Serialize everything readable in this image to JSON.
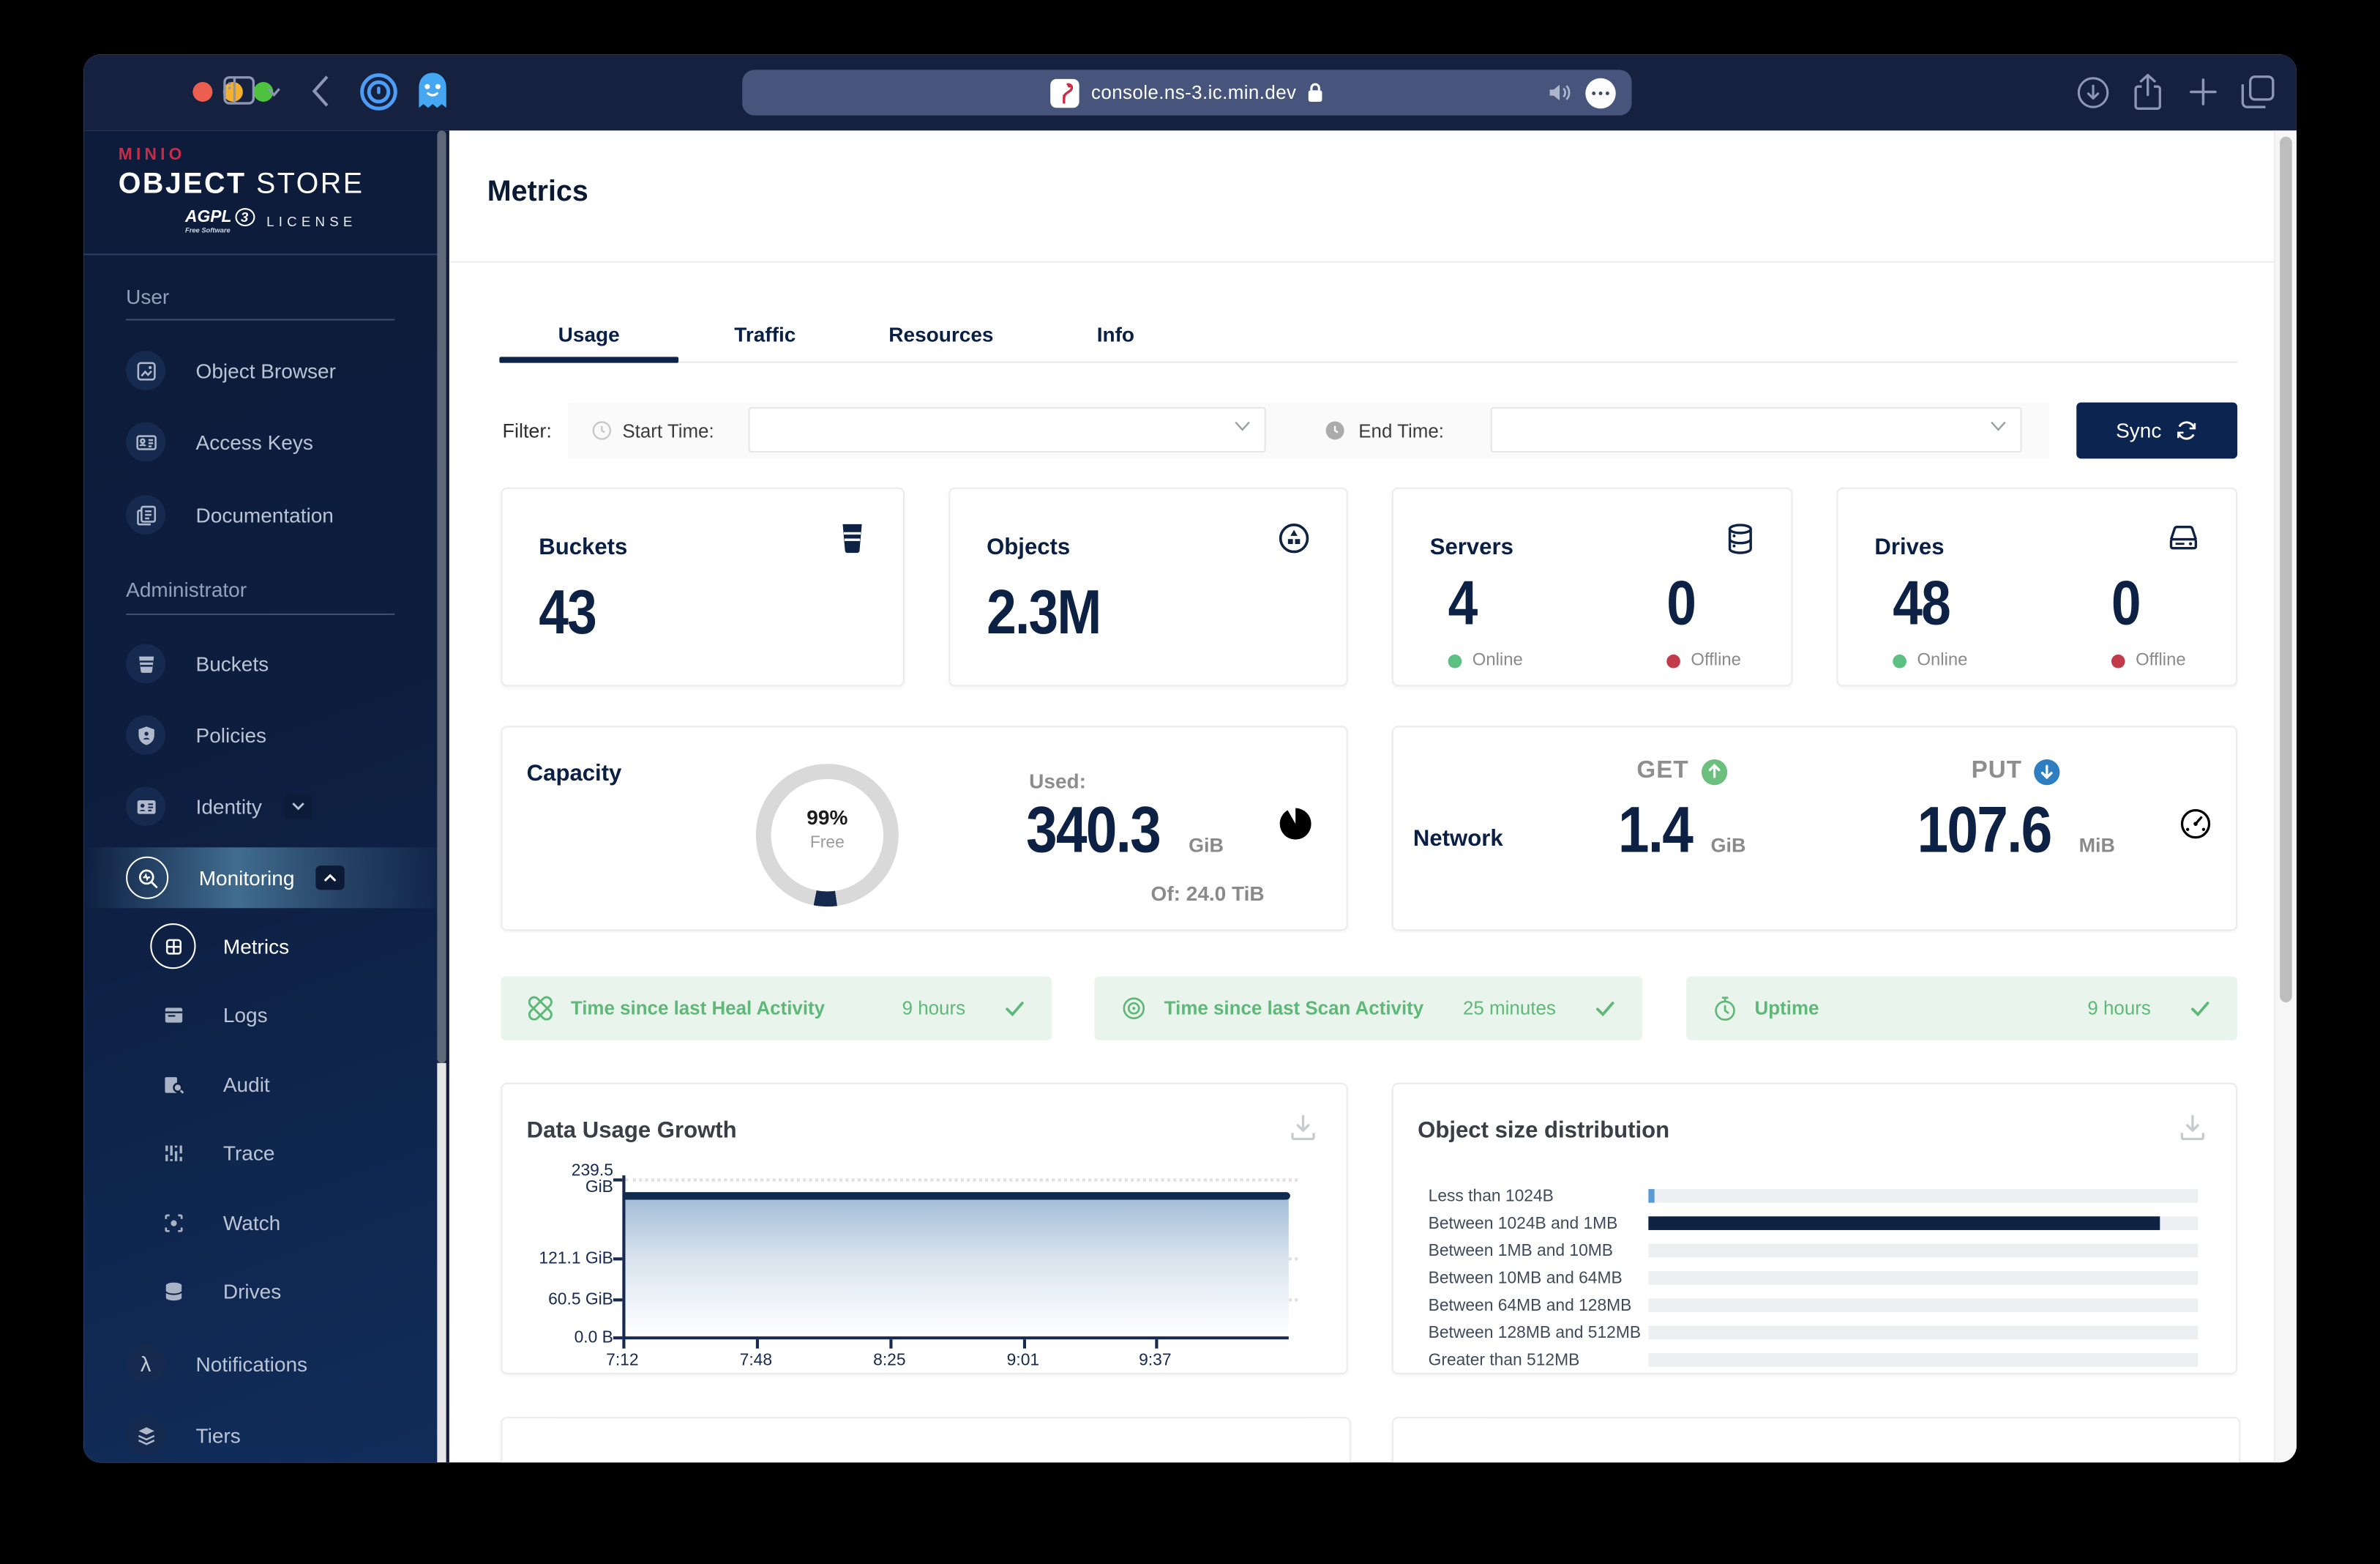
{
  "browser": {
    "url": "console.ns-3.ic.min.dev"
  },
  "sidebar": {
    "logo": {
      "brand": "MINIO",
      "product_bold": "OBJECT",
      "product_light": "STORE",
      "badge": "AGPL",
      "badge_version": "3",
      "badge_sub": "Free Software",
      "license": "LICENSE"
    },
    "user_section": "User",
    "admin_section": "Administrator",
    "items": {
      "object_browser": "Object Browser",
      "access_keys": "Access Keys",
      "documentation": "Documentation",
      "buckets": "Buckets",
      "policies": "Policies",
      "identity": "Identity",
      "monitoring": "Monitoring",
      "metrics": "Metrics",
      "logs": "Logs",
      "audit": "Audit",
      "trace": "Trace",
      "watch": "Watch",
      "drives": "Drives",
      "notifications": "Notifications",
      "tiers": "Tiers"
    },
    "active_item": "Monitoring / Metrics"
  },
  "main": {
    "title": "Metrics",
    "tabs": {
      "usage": "Usage",
      "traffic": "Traffic",
      "resources": "Resources",
      "info": "Info",
      "active": "Usage"
    },
    "filter": {
      "label": "Filter:",
      "start_label": "Start Time:",
      "start_value": "",
      "end_label": "End Time:",
      "end_value": "",
      "sync": "Sync"
    },
    "stats": {
      "buckets": {
        "label": "Buckets",
        "value": "43"
      },
      "objects": {
        "label": "Objects",
        "value": "2.3M"
      },
      "servers": {
        "label": "Servers",
        "online": "4",
        "online_label": "Online",
        "offline": "0",
        "offline_label": "Offline"
      },
      "drives": {
        "label": "Drives",
        "online": "48",
        "online_label": "Online",
        "offline": "0",
        "offline_label": "Offline"
      }
    },
    "capacity": {
      "label": "Capacity",
      "free_pct": "99%",
      "free_label": "Free",
      "used_label": "Used:",
      "used_value": "340.3",
      "used_unit": "GiB",
      "of_total": "Of: 24.0 TiB"
    },
    "network": {
      "label": "Network",
      "get_label": "GET",
      "get_value": "1.4",
      "get_unit": "GiB",
      "put_label": "PUT",
      "put_value": "107.6",
      "put_unit": "MiB"
    },
    "status_bars": [
      {
        "label": "Time since last Heal Activity",
        "value": "9 hours"
      },
      {
        "label": "Time since last Scan Activity",
        "value": "25 minutes"
      },
      {
        "label": "Uptime",
        "value": "9 hours"
      }
    ]
  },
  "chart_data": [
    {
      "type": "area",
      "title": "Data Usage Growth",
      "x_ticks": [
        "7:12",
        "7:48",
        "8:25",
        "9:01",
        "9:37"
      ],
      "y_ticks": [
        "239.5 GiB",
        "121.1 GiB",
        "60.5 GiB",
        "0.0 B"
      ],
      "y_tick_top": [
        "239.5",
        "GiB"
      ],
      "ylim": [
        "0.0 B",
        "239.5 GiB"
      ],
      "series": [
        {
          "name": "Data Usage",
          "values_gib": [
            230,
            230,
            230,
            230,
            230
          ],
          "shape": "flat"
        }
      ],
      "grid": "dotted-horizontal",
      "line_color": "#10294E"
    },
    {
      "type": "bar",
      "orientation": "horizontal",
      "title": "Object size distribution",
      "bars": [
        {
          "label": "Less than 1024B",
          "pct": 1,
          "color": "#5B9BD5"
        },
        {
          "label": "Between 1024B and 1MB",
          "pct": 93,
          "color": "#0E2244"
        },
        {
          "label": "Between 1MB and 10MB",
          "pct": 0,
          "color": "#0E2244"
        },
        {
          "label": "Between 10MB and 64MB",
          "pct": 0,
          "color": "#0E2244"
        },
        {
          "label": "Between 64MB and 128MB",
          "pct": 0,
          "color": "#0E2244"
        },
        {
          "label": "Between 128MB and 512MB",
          "pct": 0,
          "color": "#0E2244"
        },
        {
          "label": "Greater than 512MB",
          "pct": 0,
          "color": "#0E2244"
        }
      ],
      "track_color": "#EDEFF2"
    }
  ],
  "colors": {
    "titlebar": "#15213F",
    "navy": "#0A1F44",
    "green": "#5FB878",
    "green_bg": "#E9F5EC",
    "red": "#C13B4A",
    "get_green": "#6CBF7D",
    "put_blue": "#2F7EC1",
    "brand_red": "#C72C48"
  }
}
